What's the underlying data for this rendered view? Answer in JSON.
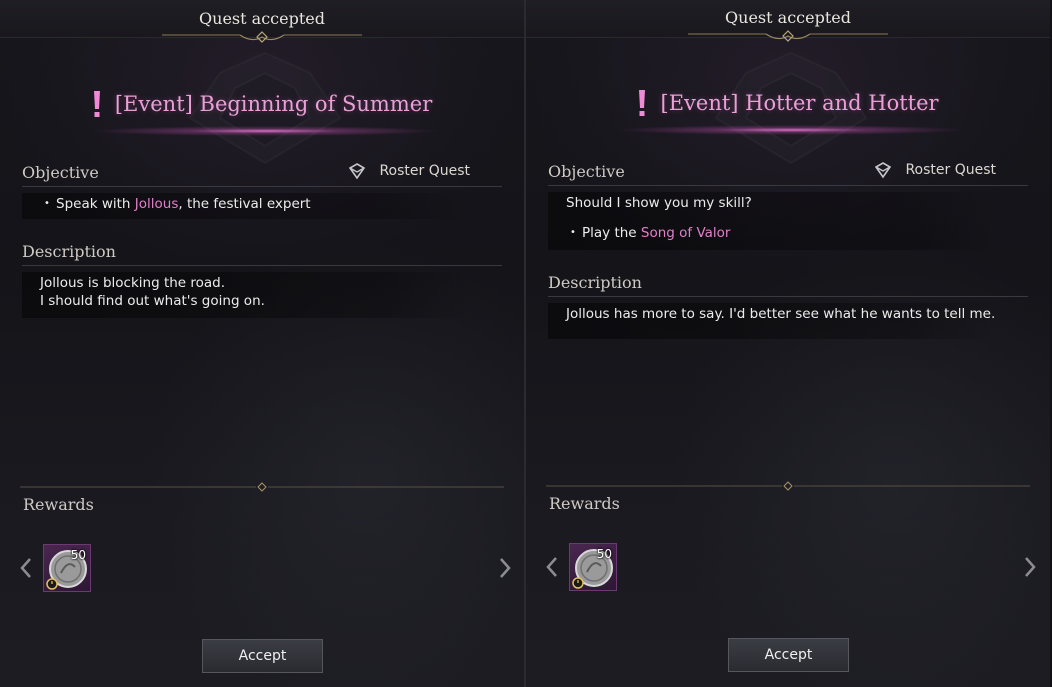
{
  "panels": [
    {
      "header_title": "Quest accepted",
      "quest_title": "[Event] Beginning of Summer",
      "objective_label": "Objective",
      "roster_label": "Roster Quest",
      "objective_intro": "",
      "objective_prefix": "Speak with ",
      "objective_highlight": "Jollous",
      "objective_suffix": ", the festival expert",
      "description_label": "Description",
      "description_lines": [
        "Jollous is blocking the road.",
        "I should find out what's going on."
      ],
      "rewards_label": "Rewards",
      "reward_count": "50",
      "accept_label": "Accept"
    },
    {
      "header_title": "Quest accepted",
      "quest_title": "[Event] Hotter and Hotter",
      "objective_label": "Objective",
      "roster_label": "Roster Quest",
      "objective_intro": "Should I show you my skill?",
      "objective_prefix": "Play the ",
      "objective_highlight": "Song of Valor",
      "objective_suffix": "",
      "description_label": "Description",
      "description_lines": [
        "Jollous has more to say. I'd better see what he wants to tell me."
      ],
      "rewards_label": "Rewards",
      "reward_count": "50",
      "accept_label": "Accept"
    }
  ],
  "icons": {
    "alert": "exclamation-icon",
    "roster": "roster-quest-icon",
    "reward": "coin-reward-icon",
    "timer": "timer-icon",
    "prev": "chevron-left-icon",
    "next": "chevron-right-icon"
  },
  "colors": {
    "title_pink": "#e9a0d6",
    "highlight_pink": "#e080c8",
    "reward_slot": "#4a2650"
  }
}
